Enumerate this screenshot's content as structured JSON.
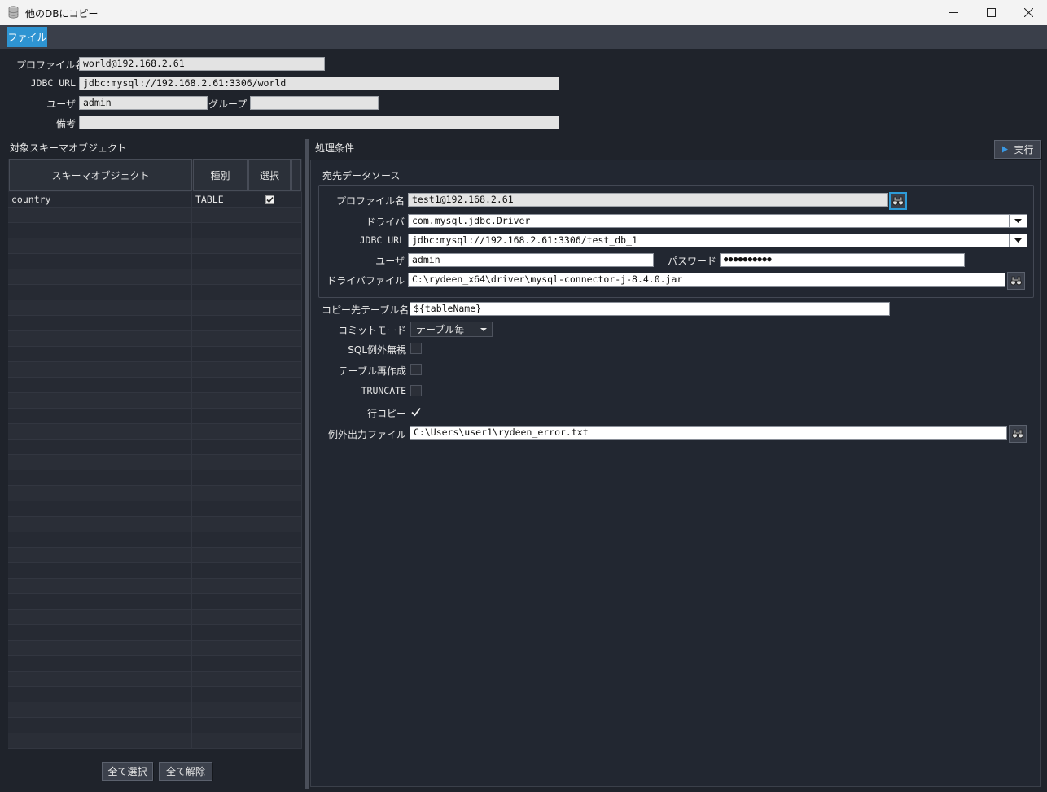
{
  "window": {
    "title": "他のDBにコピー"
  },
  "menu": {
    "file": "ファイル"
  },
  "source": {
    "profile_label": "プロファイル名",
    "profile_value": "world@192.168.2.61",
    "jdbc_label": "JDBC URL",
    "jdbc_value": "jdbc:mysql://192.168.2.61:3306/world",
    "user_label": "ユーザ",
    "user_value": "admin",
    "group_label": "グループ",
    "group_value": "",
    "note_label": "備考",
    "note_value": ""
  },
  "objects": {
    "title": "対象スキーマオブジェクト",
    "columns": [
      "スキーマオブジェクト",
      "種別",
      "選択"
    ],
    "rows": [
      {
        "name": "country",
        "type": "TABLE",
        "selected": true
      }
    ],
    "select_all": "全て選択",
    "deselect_all": "全て解除"
  },
  "conditions": {
    "title": "処理条件",
    "run_label": "実行",
    "dest_title": "宛先データソース",
    "dest_profile_label": "プロファイル名",
    "dest_profile_value": "test1@192.168.2.61",
    "driver_label": "ドライバ",
    "driver_value": "com.mysql.jdbc.Driver",
    "dest_jdbc_label": "JDBC URL",
    "dest_jdbc_value": "jdbc:mysql://192.168.2.61:3306/test_db_1",
    "dest_user_label": "ユーザ",
    "dest_user_value": "admin",
    "password_label": "パスワード",
    "password_value": "●●●●●●●●●●",
    "driver_file_label": "ドライバファイル",
    "driver_file_value": "C:\\rydeen_x64\\driver\\mysql-connector-j-8.4.0.jar",
    "copy_table_label": "コピー先テーブル名",
    "copy_table_value": "${tableName}",
    "commit_mode_label": "コミットモード",
    "commit_mode_value": "テーブル毎",
    "ignore_sql_label": "SQL例外無視",
    "ignore_sql_checked": false,
    "recreate_label": "テーブル再作成",
    "recreate_checked": false,
    "truncate_label": "TRUNCATE",
    "truncate_checked": false,
    "row_copy_label": "行コピー",
    "row_copy_checked": true,
    "error_file_label": "例外出力ファイル",
    "error_file_value": "C:\\Users\\user1\\rydeen_error.txt"
  }
}
